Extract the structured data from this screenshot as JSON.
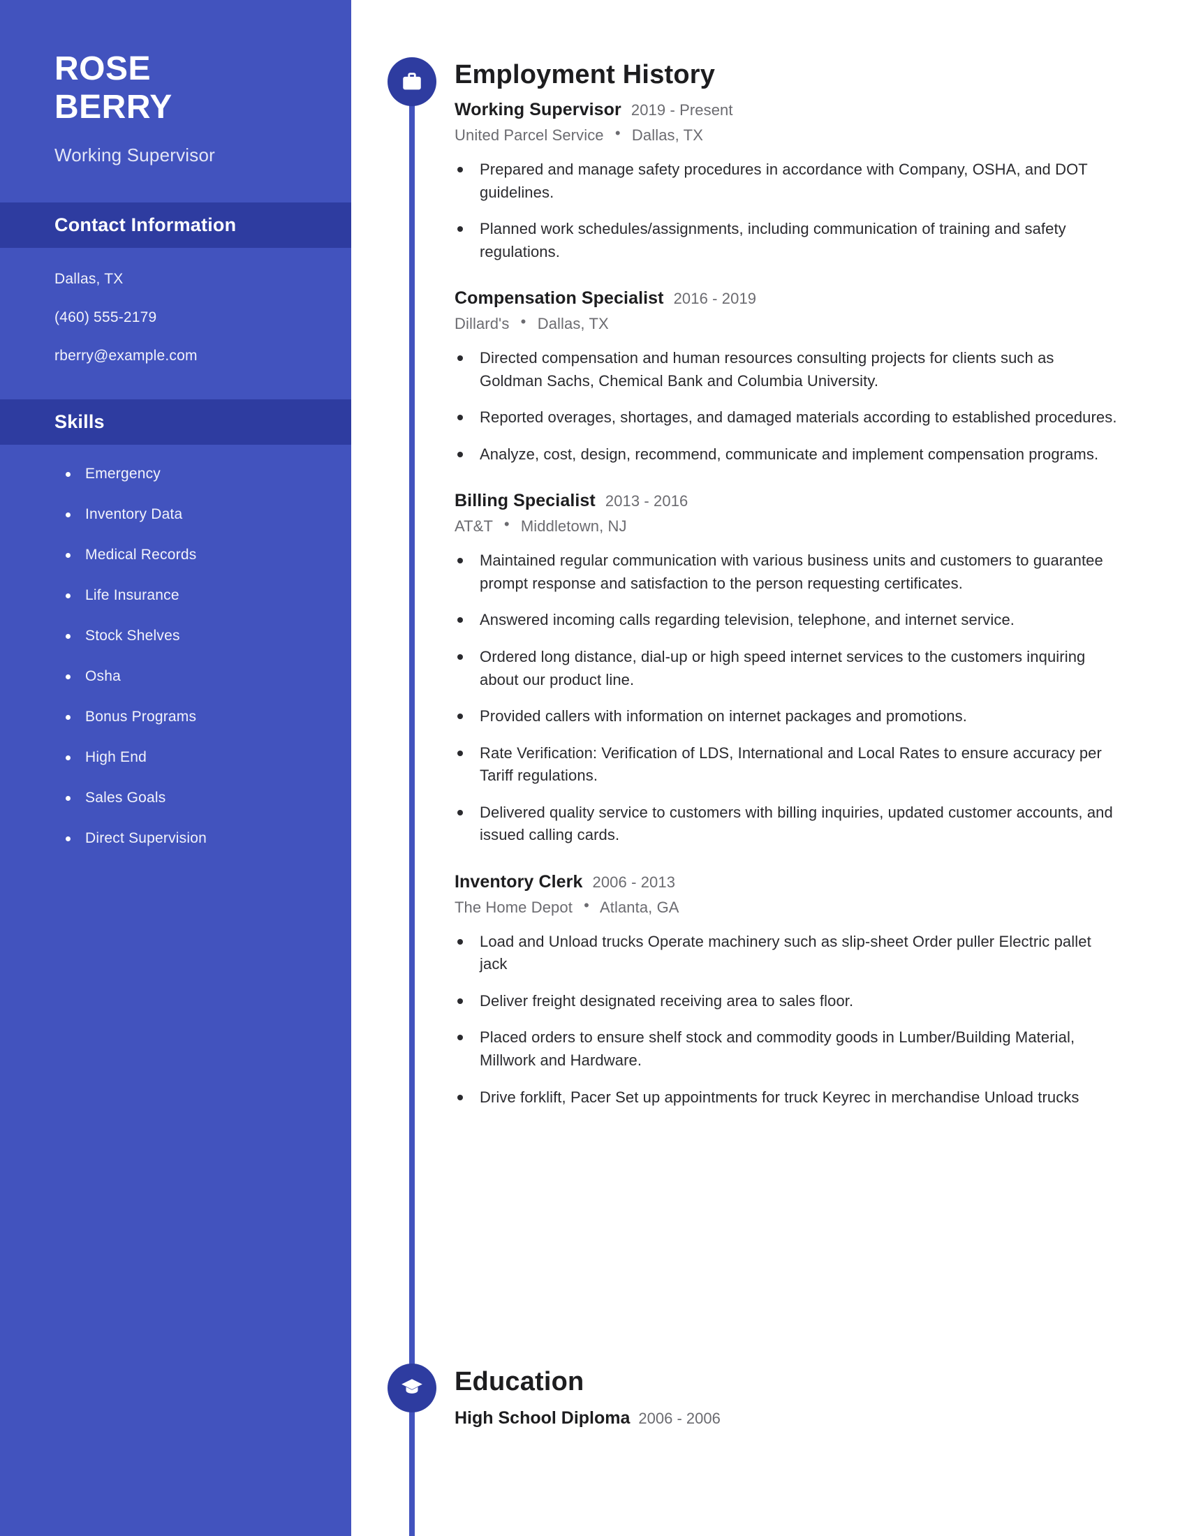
{
  "sidebar": {
    "name_first": "ROSE",
    "name_last": "BERRY",
    "job_title": "Working Supervisor",
    "contact_heading": "Contact Information",
    "contact": [
      "Dallas, TX",
      "(460) 555-2179",
      "rberry@example.com"
    ],
    "skills_heading": "Skills",
    "skills": [
      "Emergency",
      "Inventory Data",
      "Medical Records",
      "Life Insurance",
      "Stock Shelves",
      "Osha",
      "Bonus Programs",
      "High End",
      "Sales Goals",
      "Direct Supervision"
    ]
  },
  "main": {
    "employment_heading": "Employment History",
    "education_heading": "Education",
    "separator": "•",
    "jobs": [
      {
        "role": "Working Supervisor",
        "dates": "2019 - Present",
        "company": "United Parcel Service",
        "location": "Dallas, TX",
        "bullets": [
          "Prepared and manage safety procedures in accordance with Company, OSHA, and DOT guidelines.",
          "Planned work schedules/assignments, including communication of training and safety regulations."
        ]
      },
      {
        "role": "Compensation Specialist",
        "dates": "2016 - 2019",
        "company": "Dillard's",
        "location": "Dallas, TX",
        "bullets": [
          "Directed compensation and human resources consulting projects for clients such as Goldman Sachs, Chemical Bank and Columbia University.",
          "Reported overages, shortages, and damaged materials according to established procedures.",
          "Analyze, cost, design, recommend, communicate and implement compensation programs."
        ]
      },
      {
        "role": "Billing Specialist",
        "dates": "2013 - 2016",
        "company": "AT&T",
        "location": "Middletown, NJ",
        "bullets": [
          "Maintained regular communication with various business units and customers to guarantee prompt response and satisfaction to the person requesting certificates.",
          "Answered incoming calls regarding television, telephone, and internet service.",
          "Ordered long distance, dial-up or high speed internet services to the customers inquiring about our product line.",
          "Provided callers with information on internet packages and promotions.",
          "Rate Verification: Verification of LDS, International and Local Rates to ensure accuracy per Tariff regulations.",
          "Delivered quality service to customers with billing inquiries, updated customer accounts, and issued calling cards."
        ]
      },
      {
        "role": "Inventory Clerk",
        "dates": "2006 - 2013",
        "company": "The Home Depot",
        "location": "Atlanta, GA",
        "bullets": [
          "Load and Unload trucks Operate machinery such as slip-sheet Order puller Electric pallet jack",
          "Deliver freight designated receiving area to sales floor.",
          "Placed orders to ensure shelf stock and commodity goods in Lumber/Building Material, Millwork and Hardware.",
          "Drive forklift, Pacer Set up appointments for truck Keyrec in merchandise Unload trucks"
        ]
      }
    ],
    "education": [
      {
        "degree": "High School Diploma",
        "dates": "2006 - 2006"
      }
    ]
  },
  "colors": {
    "sidebar_bg": "#4253be",
    "band_bg": "#2e3ca0",
    "node_bg": "#2e3ca0",
    "timeline": "#4253be",
    "text_dark": "#1d1d1f",
    "text_muted": "#6b6b70"
  }
}
